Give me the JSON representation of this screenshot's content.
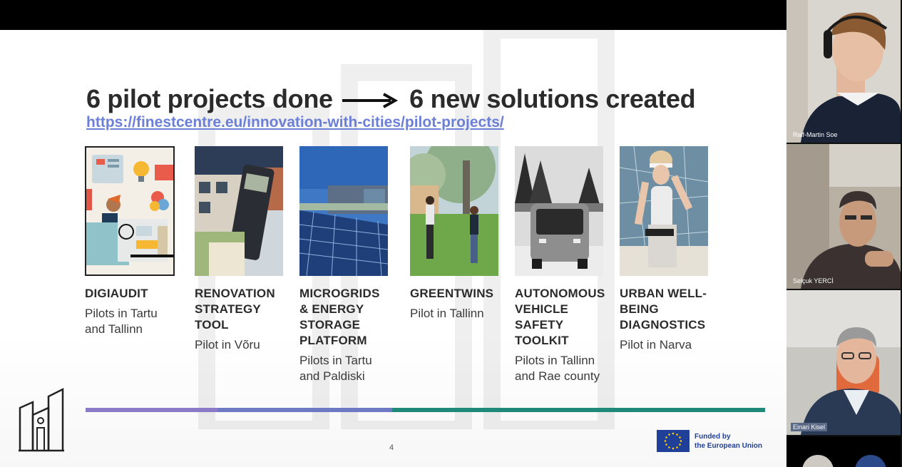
{
  "slide": {
    "title_left": "6 pilot projects done",
    "title_right": "6 new solutions created",
    "link": "https://finestcentre.eu/innovation-with-cities/pilot-projects/",
    "page_number": "4",
    "funding": {
      "line1": "Funded by",
      "line2": "the European Union"
    },
    "projects": [
      {
        "name": "DIGIAUDIT",
        "sub": "Pilots in Tartu and Tallinn"
      },
      {
        "name": "RENOVATION STRATEGY TOOL",
        "sub": "Pilot in Võru"
      },
      {
        "name": "MICROGRIDS & ENERGY STORAGE PLATFORM",
        "sub": "Pilots in Tartu and Paldiski"
      },
      {
        "name": "GREENTWINS",
        "sub": "Pilot in Tallinn"
      },
      {
        "name": "AUTONOMOUS VEHICLE SAFETY TOOLKIT",
        "sub": "Pilots in Tallinn and Rae county"
      },
      {
        "name": "URBAN WELL-BEING DIAGNOSTICS",
        "sub": "Pilot in Narva"
      }
    ],
    "colors": {
      "purple": "#8a7ac7",
      "indigo": "#6e78c4",
      "teal": "#1f8a7a",
      "link": "#6b7fd6"
    }
  },
  "participants": [
    {
      "name": "Ralf-Martin Soe"
    },
    {
      "name": "Selçuk YERCİ"
    },
    {
      "name": "Einari Kisel"
    }
  ]
}
